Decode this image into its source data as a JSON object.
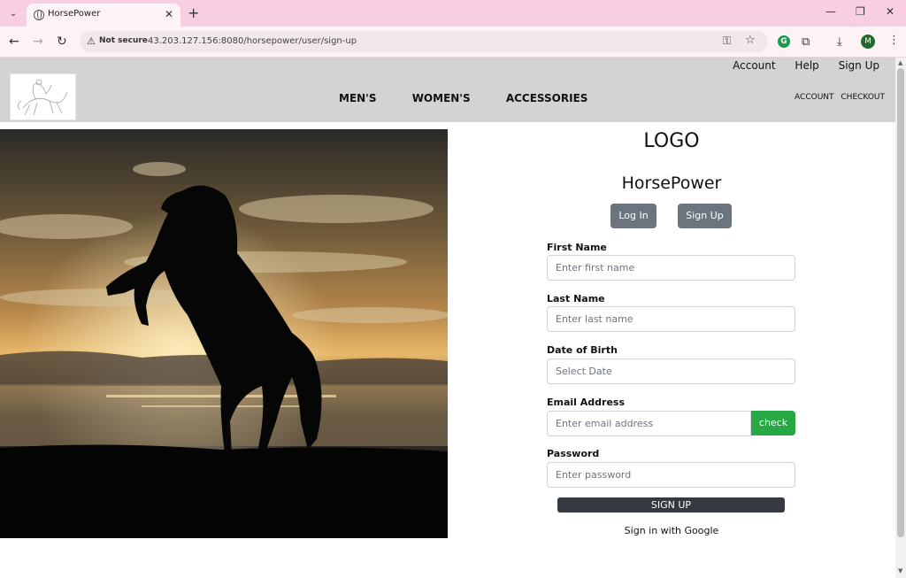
{
  "browser": {
    "tab_title": "HorsePower",
    "not_secure": "Not secure",
    "url": "43.203.127.156:8080/horsepower/user/sign-up",
    "profile_initial": "M"
  },
  "header": {
    "top_links": [
      "Account",
      "Help",
      "Sign Up"
    ],
    "nav": [
      "MEN'S",
      "WOMEN'S",
      "ACCESSORIES"
    ],
    "util_links": [
      "ACCOUNT",
      "CHECKOUT"
    ]
  },
  "form": {
    "logo_text": "LOGO",
    "brand": "HorsePower",
    "login_label": "Log In",
    "signup_tab_label": "Sign Up",
    "first_name_label": "First Name",
    "first_name_placeholder": "Enter first name",
    "last_name_label": "Last Name",
    "last_name_placeholder": "Enter last name",
    "dob_label": "Date of Birth",
    "dob_placeholder": "Select Date",
    "email_label": "Email Address",
    "email_placeholder": "Enter email address",
    "check_label": "check",
    "password_label": "Password",
    "password_placeholder": "Enter password",
    "submit_label": "SIGN UP",
    "google_label": "Sign in with Google"
  },
  "colors": {
    "tabbar": "#f7cfe1",
    "header": "#d3d3d3",
    "secondary_button": "#6c757d",
    "check_button": "#28a745",
    "submit_button": "#343a40"
  }
}
